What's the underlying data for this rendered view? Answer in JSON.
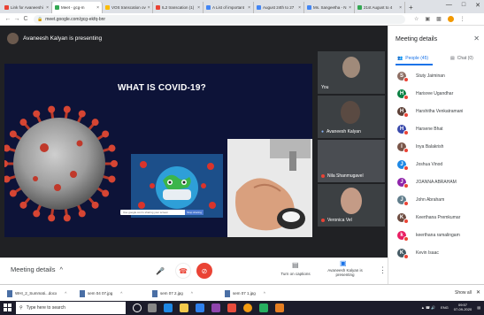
{
  "browser": {
    "tabs": [
      {
        "title": "Link for Avaneeshi",
        "fav": "#ea4335"
      },
      {
        "title": "Meet - gcg-m",
        "fav": "#34a853",
        "active": true
      },
      {
        "title": "VOS transcation ov",
        "fav": "#fbbc05"
      },
      {
        "title": "IL2 transcation (1)",
        "fav": "#ea4335"
      },
      {
        "title": "A List of important",
        "fav": "#4285f4"
      },
      {
        "title": "August 24th to 27",
        "fav": "#4285f4"
      },
      {
        "title": "Ms. Sangeetha - N",
        "fav": "#4285f4"
      },
      {
        "title": "21st August to 4",
        "fav": "#34a853"
      }
    ],
    "new_tab": "+",
    "window_controls": [
      "—",
      "□",
      "✕"
    ],
    "url": "meet.google.com/gcg-ekfq-bnr",
    "nav": [
      "←",
      "→",
      "C"
    ]
  },
  "meet": {
    "presenter_text": "Avaneesh Kalyan is presenting",
    "slide_title": "WHAT IS COVID-19?",
    "slide_caption": "Use google.com's sharing your screen",
    "slide_caption_button": "Stop sharing",
    "tiles": [
      {
        "name": "You",
        "muted": false
      },
      {
        "name": "Avaneesh Kalyan",
        "muted": false
      },
      {
        "name": "Nila Shanmugavel",
        "muted": true
      },
      {
        "name": "Veronica Vel",
        "muted": true
      }
    ],
    "bottom": {
      "meeting_details": "Meeting details",
      "meeting_details_chevron": "^",
      "captions_label": "Turn on captions",
      "presenting_label": "Avaneesh Kalyan is presenting"
    }
  },
  "panel": {
    "title": "Meeting details",
    "close": "✕",
    "tabs": [
      {
        "label": "People (45)",
        "active": true
      },
      {
        "label": "Chat (0)",
        "active": false
      }
    ],
    "people": [
      {
        "name": "Stuty Jaiminan",
        "initial": "S",
        "color": "#8d6e63"
      },
      {
        "name": "Harisree Ugandhar",
        "initial": "H",
        "color": "#0b8043"
      },
      {
        "name": "Harshitha Venkatramani",
        "initial": "H",
        "color": "#5d4037"
      },
      {
        "name": "Harsene Bhat",
        "initial": "H",
        "color": "#3949ab"
      },
      {
        "name": "Inya Balakrish",
        "initial": "I",
        "color": "#795548"
      },
      {
        "name": "Joshua Vinod",
        "initial": "J",
        "color": "#1e88e5"
      },
      {
        "name": "JOANNA ABRAHAM",
        "initial": "J",
        "color": "#8e24aa"
      },
      {
        "name": "John Abraham",
        "initial": "J",
        "color": "#607d8b"
      },
      {
        "name": "Keerthana Premkumar",
        "initial": "K",
        "color": "#6d4c41"
      },
      {
        "name": "keerthana ramalingam",
        "initial": "k",
        "color": "#e91e63"
      },
      {
        "name": "Kevin Isaac",
        "initial": "K",
        "color": "#455a64"
      }
    ]
  },
  "downloads": {
    "items": [
      "WHI_2_Summati...docx",
      "sem 04 07.jpg",
      "sem 07 2.jpg",
      "sem 07 1.jpg"
    ],
    "show_all": "Show all",
    "close": "✕"
  },
  "taskbar": {
    "search_placeholder": "Type here to search",
    "time": "09:57",
    "date": "07-09-2020",
    "lang": "ENG"
  }
}
